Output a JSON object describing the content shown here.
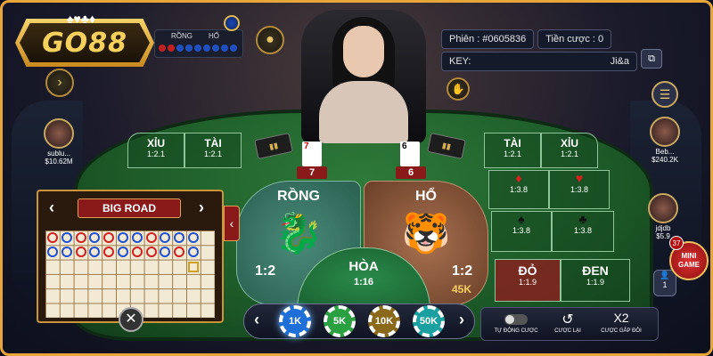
{
  "logo": {
    "text": "GO88"
  },
  "mini_road": {
    "rong_label": "RỒNG",
    "ho_label": "HỔ"
  },
  "info": {
    "session_label": "Phiên : #0605836",
    "bet_label": "Tiền cược : 0",
    "key_label": "KEY:",
    "key_value": "Ji&a"
  },
  "players": [
    {
      "name": "sublu...",
      "balance": "$10.62M"
    },
    {
      "name": "Beb...",
      "balance": "$240.2K"
    },
    {
      "name": "jdjdb",
      "balance": "$5.9"
    }
  ],
  "cards": {
    "rong_card": "7",
    "ho_card": "6",
    "rong_score": "7",
    "ho_score": "6"
  },
  "side_bets_left": [
    {
      "title": "XỈU",
      "odds": "1:2.1"
    },
    {
      "title": "TÀI",
      "odds": "1:2.1"
    }
  ],
  "side_bets_right": [
    {
      "title": "TÀI",
      "odds": "1:2.1"
    },
    {
      "title": "XỈU",
      "odds": "1:2.1"
    }
  ],
  "suit_bets_right": [
    {
      "suit": "♦",
      "odds": "1:3.8"
    },
    {
      "suit": "♥",
      "odds": "1:3.8"
    },
    {
      "suit": "♠",
      "odds": "1:3.8"
    },
    {
      "suit": "♣",
      "odds": "1:3.8"
    }
  ],
  "color_bets": [
    {
      "title": "ĐỎ",
      "odds": "1:1.9"
    },
    {
      "title": "ĐEN",
      "odds": "1:1.9"
    }
  ],
  "main_bets": {
    "rong_title": "RỒNG",
    "rong_ratio": "1:2",
    "ho_title": "HỔ",
    "ho_ratio": "1:2",
    "ho_amount": "45K",
    "hoa_title": "HÒA",
    "hoa_ratio": "1:16"
  },
  "big_road": {
    "title": "BIG ROAD",
    "columns": [
      [
        "red",
        "blue",
        null,
        null,
        null,
        null
      ],
      [
        "blue",
        "blue",
        null,
        null,
        null,
        null
      ],
      [
        "red",
        "red",
        null,
        null,
        null,
        null
      ],
      [
        "blue",
        "blue",
        null,
        null,
        null,
        null
      ],
      [
        "red",
        "red",
        null,
        null,
        null,
        null
      ],
      [
        "blue",
        "blue",
        null,
        null,
        null,
        null
      ],
      [
        "blue",
        "red",
        null,
        null,
        null,
        null
      ],
      [
        "red",
        "red",
        null,
        null,
        null,
        null
      ],
      [
        "blue",
        "blue",
        null,
        null,
        null,
        null
      ],
      [
        "blue",
        "red",
        null,
        null,
        null,
        null
      ],
      [
        "blue",
        "blue",
        "yellow",
        null,
        null,
        null
      ]
    ]
  },
  "chips": [
    {
      "label": "1K",
      "color": "#1e6fd8"
    },
    {
      "label": "5K",
      "color": "#2aa040"
    },
    {
      "label": "10K",
      "color": "#8a6a1a"
    },
    {
      "label": "50K",
      "color": "#1aa0a0"
    }
  ],
  "controls": {
    "auto_label": "TỰ ĐỘNG CƯỢC",
    "undo_label": "CƯỢC LẠI",
    "x2_label": "CƯỢC GẤP ĐÔI",
    "x2_text": "X2"
  },
  "minigame": {
    "badge": "37",
    "label": "MINI GAME"
  },
  "user_count": "1"
}
